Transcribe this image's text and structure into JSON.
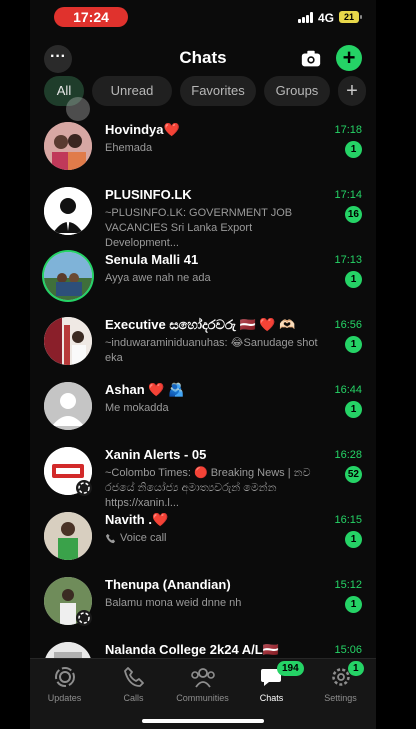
{
  "status_bar": {
    "time": "17:24",
    "network": "4G",
    "battery": "21"
  },
  "header": {
    "title": "Chats",
    "more_icon": "ellipsis-icon",
    "camera_icon": "camera-icon",
    "add_icon": "plus-icon",
    "accent": "#25d366"
  },
  "filters": [
    {
      "label": "All",
      "active": true
    },
    {
      "label": "Unread",
      "active": false
    },
    {
      "label": "Favorites",
      "active": false
    },
    {
      "label": "Groups",
      "active": false
    },
    {
      "label": "+",
      "active": false
    }
  ],
  "chats": [
    {
      "name": "Hovindya❤️",
      "preview": "Ehemada",
      "time": "17:18",
      "unread": "1"
    },
    {
      "name": "PLUSINFO.LK",
      "preview": "~PLUSINFO.LK: GOVERNMENT JOB VACANCIES Sri Lanka Export Development...",
      "time": "17:14",
      "unread": "16"
    },
    {
      "name": "Senula Malli 41",
      "preview": "Ayya awe nah ne ada",
      "time": "17:13",
      "unread": "1"
    },
    {
      "name": "Executive සහෝදරවරු 🇱🇻 ❤️ 🫶🏻",
      "preview": "~induwaraminiduanuhas: 😂Sanudage shot eka",
      "time": "16:56",
      "unread": "1"
    },
    {
      "name": "Ashan ❤️ 🫂",
      "preview": "Me mokadda",
      "time": "16:44",
      "unread": "1"
    },
    {
      "name": "Xanin Alerts - 05",
      "preview": "~Colombo Times: 🔴 Breaking News | නව රජයේ නියෝජ්‍ය අමාත්‍යවරුන් මෙන්න  https://xanin.l...",
      "time": "16:28",
      "unread": "52"
    },
    {
      "name": "Navith .❤️",
      "preview": "Voice call",
      "time": "16:15",
      "unread": "1"
    },
    {
      "name": "Thenupa (Anandian)",
      "preview": "Balamu mona weid dnne nh",
      "time": "15:12",
      "unread": "1"
    },
    {
      "name": "Nalanda College 2k24 A/L🇱🇻",
      "preview": "",
      "time": "15:06",
      "unread": ""
    }
  ],
  "tabs": [
    {
      "label": "Updates",
      "icon": "updates-icon",
      "badge": ""
    },
    {
      "label": "Calls",
      "icon": "phone-icon",
      "badge": ""
    },
    {
      "label": "Communities",
      "icon": "communities-icon",
      "badge": ""
    },
    {
      "label": "Chats",
      "icon": "chats-icon",
      "badge": "194"
    },
    {
      "label": "Settings",
      "icon": "gear-icon",
      "badge": "1"
    }
  ]
}
